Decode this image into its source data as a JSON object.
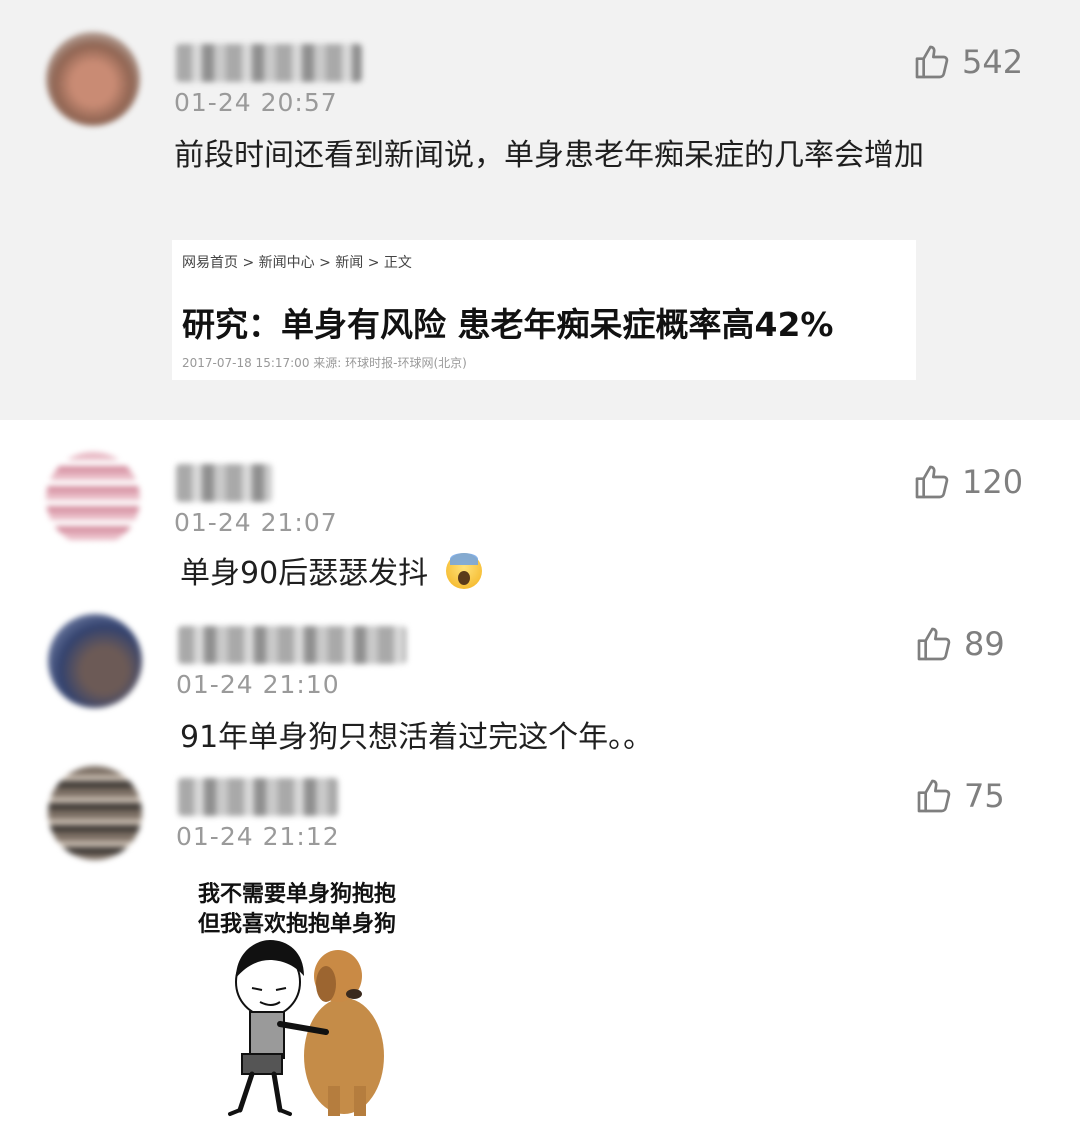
{
  "comments": [
    {
      "time": "01-24 20:57",
      "likes": "542",
      "text": "前段时间还看到新闻说，单身患老年痴呆症的几率会增加",
      "news_card": {
        "breadcrumb": "网易首页 > 新闻中心 > 新闻 > 正文",
        "title": "研究：单身有风险 患老年痴呆症概率高42%",
        "meta": "2017-07-18 15:17:00   来源: 环球时报-环球网(北京)"
      }
    },
    {
      "time": "01-24 21:07",
      "likes": "120",
      "text": "单身90后瑟瑟发抖"
    },
    {
      "time": "01-24 21:10",
      "likes": "89",
      "text": "91年单身狗只想活着过完这个年。。"
    },
    {
      "time": "01-24 21:12",
      "likes": "75",
      "meme": {
        "line1": "我不需要单身狗抱抱",
        "line2": "但我喜欢抱抱单身狗"
      }
    }
  ],
  "icons": {
    "like": "thumbs-up-icon",
    "emoji": "face-screaming-in-fear-emoji"
  },
  "colors": {
    "highlight_bg": "#f2f2f2",
    "meta_gray": "#9a9a9a"
  }
}
